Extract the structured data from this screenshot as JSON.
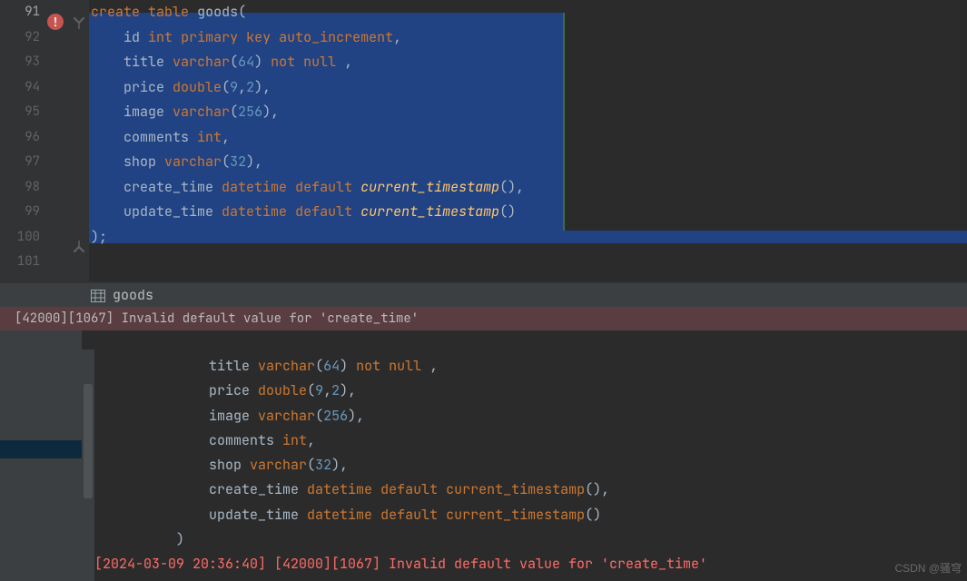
{
  "gutter": {
    "lines": [
      "91",
      "92",
      "93",
      "94",
      "95",
      "96",
      "97",
      "98",
      "99",
      "100",
      "101"
    ],
    "activeIndex": 0
  },
  "editor_sql": {
    "l91": {
      "a": "create",
      "b": "table",
      "c": "goods",
      "d": "("
    },
    "l92": {
      "a": "id",
      "b": "int",
      "c": "primary",
      "d": "key",
      "e": "auto_increment",
      "f": ","
    },
    "l93": {
      "a": "title",
      "b": "varchar",
      "c": "(",
      "d": "64",
      "e": ")",
      "f": "not",
      "g": "null",
      "h": ","
    },
    "l94": {
      "a": "price",
      "b": "double",
      "c": "(",
      "d": "9",
      "e": ",",
      "f": "2",
      "g": ")",
      "h": ","
    },
    "l95": {
      "a": "image",
      "b": "varchar",
      "c": "(",
      "d": "256",
      "e": ")",
      "f": ","
    },
    "l96": {
      "a": "comments",
      "b": "int",
      "c": ","
    },
    "l97": {
      "a": "shop",
      "b": "varchar",
      "c": "(",
      "d": "32",
      "e": ")",
      "f": ","
    },
    "l98": {
      "a": "create_time",
      "b": "datetime",
      "c": "default",
      "d": "current_timestamp",
      "e": "()",
      "f": ","
    },
    "l99": {
      "a": "update_time",
      "b": "datetime",
      "c": "default",
      "d": "current_timestamp",
      "e": "()"
    },
    "l100": {
      "a": ")",
      "b": ";"
    }
  },
  "breadcrumb": {
    "icon": "table-icon",
    "text": "goods"
  },
  "top_error": "[42000][1067] Invalid default value for 'create_time'",
  "console": {
    "l1": {
      "a": "title",
      "b": "varchar",
      "c": "(",
      "d": "64",
      "e": ")",
      "f": "not",
      "g": "null",
      "h": ","
    },
    "l2": {
      "a": "price",
      "b": "double",
      "c": "(",
      "d": "9",
      "e": ",",
      "f": "2",
      "g": ")",
      "h": ","
    },
    "l3": {
      "a": "image",
      "b": "varchar",
      "c": "(",
      "d": "256",
      "e": ")",
      "f": ","
    },
    "l4": {
      "a": "comments",
      "b": "int",
      "c": ","
    },
    "l5": {
      "a": "shop",
      "b": "varchar",
      "c": "(",
      "d": "32",
      "e": ")",
      "f": ","
    },
    "l6": {
      "a": "create_time",
      "b": "datetime",
      "c": "default",
      "d": "current_timestamp",
      "e": "()",
      "f": ","
    },
    "l7": {
      "a": "update_time",
      "b": "datetime",
      "c": "default",
      "d": "current_timestamp",
      "e": "()"
    },
    "l8": {
      "a": ")"
    },
    "err": "[2024-03-09 20:36:40] [42000][1067] Invalid default value for 'create_time'"
  },
  "watermark": "CSDN @骚穹"
}
